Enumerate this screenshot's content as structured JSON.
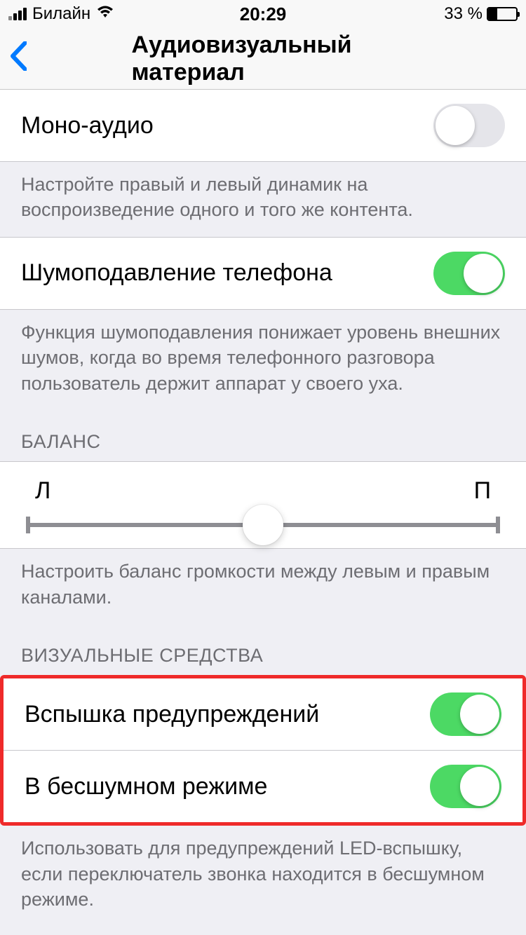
{
  "status": {
    "carrier": "Билайн",
    "time": "20:29",
    "battery_text": "33 %"
  },
  "nav": {
    "title": "Аудиовизуальный материал"
  },
  "mono_audio": {
    "label": "Моно-аудио",
    "on": false,
    "footer": "Настройте правый и левый динамик на воспроизведение одного и того же контента."
  },
  "noise_cancel": {
    "label": "Шумоподавление телефона",
    "on": true,
    "footer": "Функция шумоподавления понижает уровень внешних шумов, когда во время телефонного разговора пользователь держит аппарат у своего уха."
  },
  "balance": {
    "header": "БАЛАНС",
    "left_label": "Л",
    "right_label": "П",
    "footer": "Настроить баланс громкости между левым и правым каналами."
  },
  "visual": {
    "header": "ВИЗУАЛЬНЫЕ СРЕДСТВА",
    "flash_alerts": {
      "label": "Вспышка предупреждений",
      "on": true
    },
    "flash_silent": {
      "label": "В бесшумном режиме",
      "on": true
    },
    "footer": "Использовать для предупреждений LED-вспышку, если переключатель звонка находится в бесшумном режиме."
  }
}
